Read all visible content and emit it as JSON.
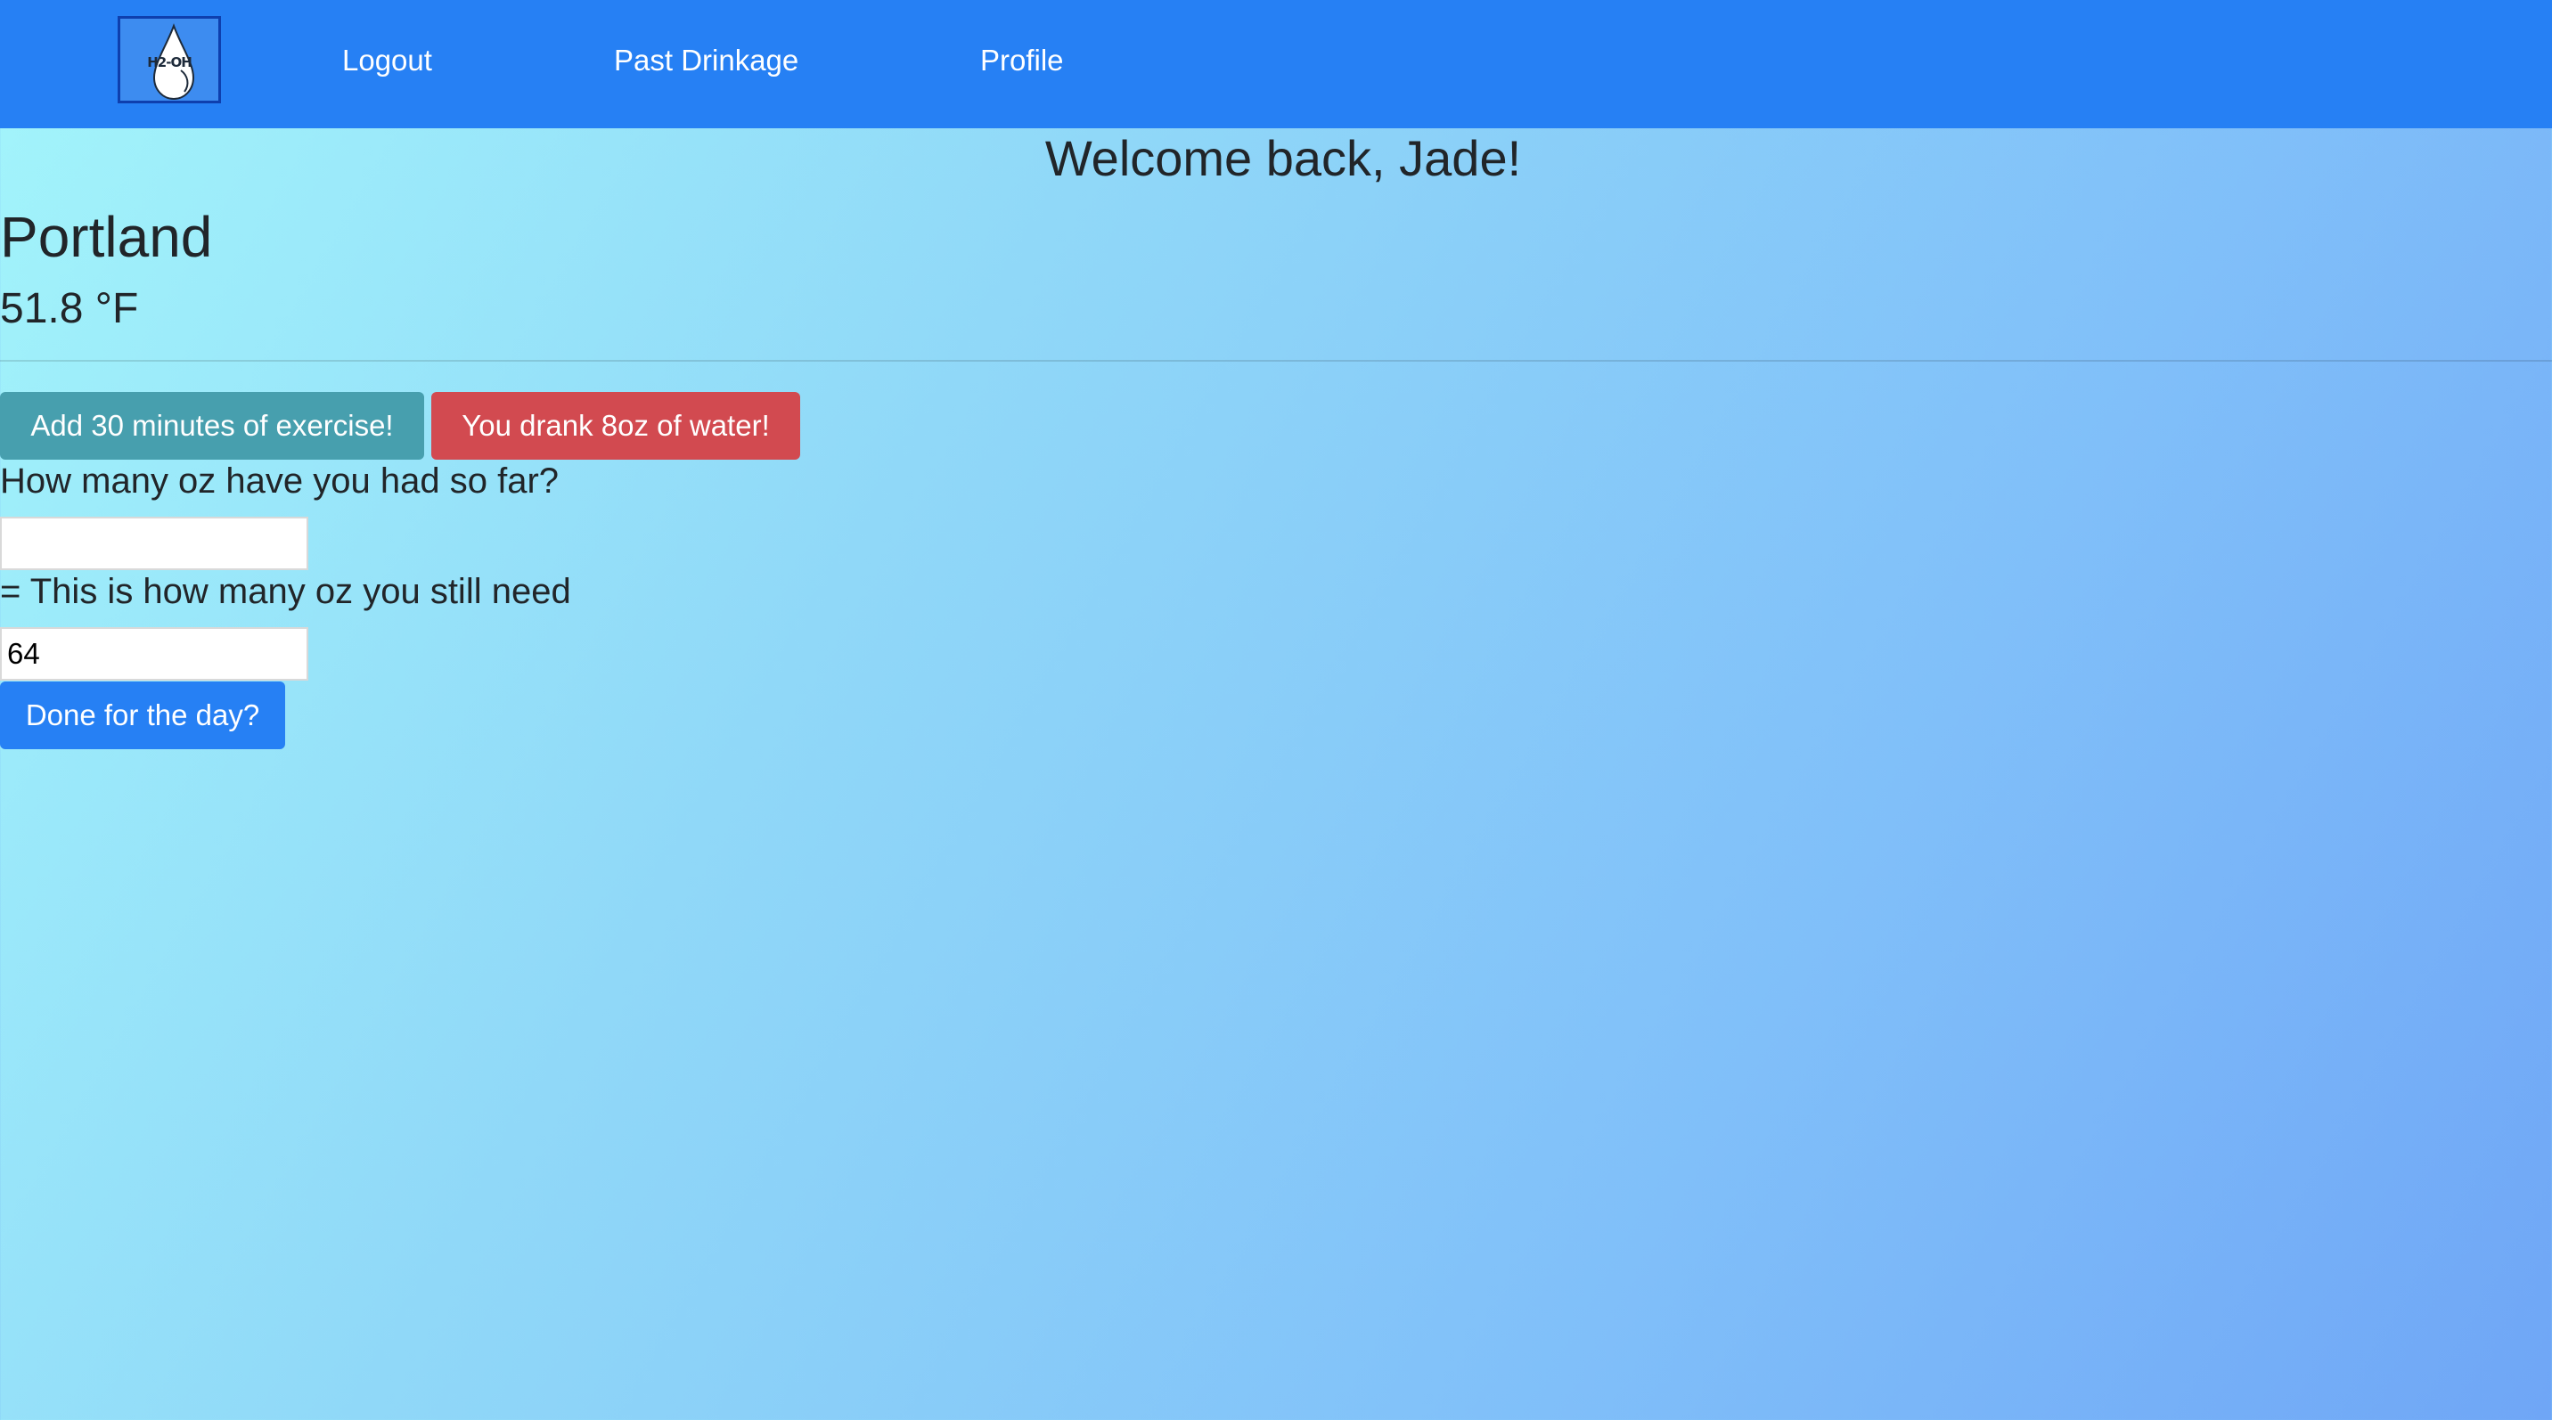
{
  "nav": {
    "logo_text": "H2-OH",
    "links": [
      {
        "label": "Logout"
      },
      {
        "label": "Past Drinkage"
      },
      {
        "label": "Profile"
      }
    ]
  },
  "welcome": "Welcome back, Jade!",
  "weather": {
    "city": "Portland",
    "temperature": "51.8 °F"
  },
  "actions": {
    "exercise_label": "Add 30 minutes of exercise!",
    "water_label": "You drank 8oz of water!"
  },
  "form": {
    "consumed_label": "How many oz have you had so far?",
    "consumed_value": "",
    "remaining_label": "= This is how many oz you still need",
    "remaining_value": "64",
    "done_label": "Done for the day?"
  },
  "colors": {
    "navbar": "#2680f4",
    "exercise_button": "#479fae",
    "water_button": "#d24a50",
    "done_button": "#2680f4"
  }
}
